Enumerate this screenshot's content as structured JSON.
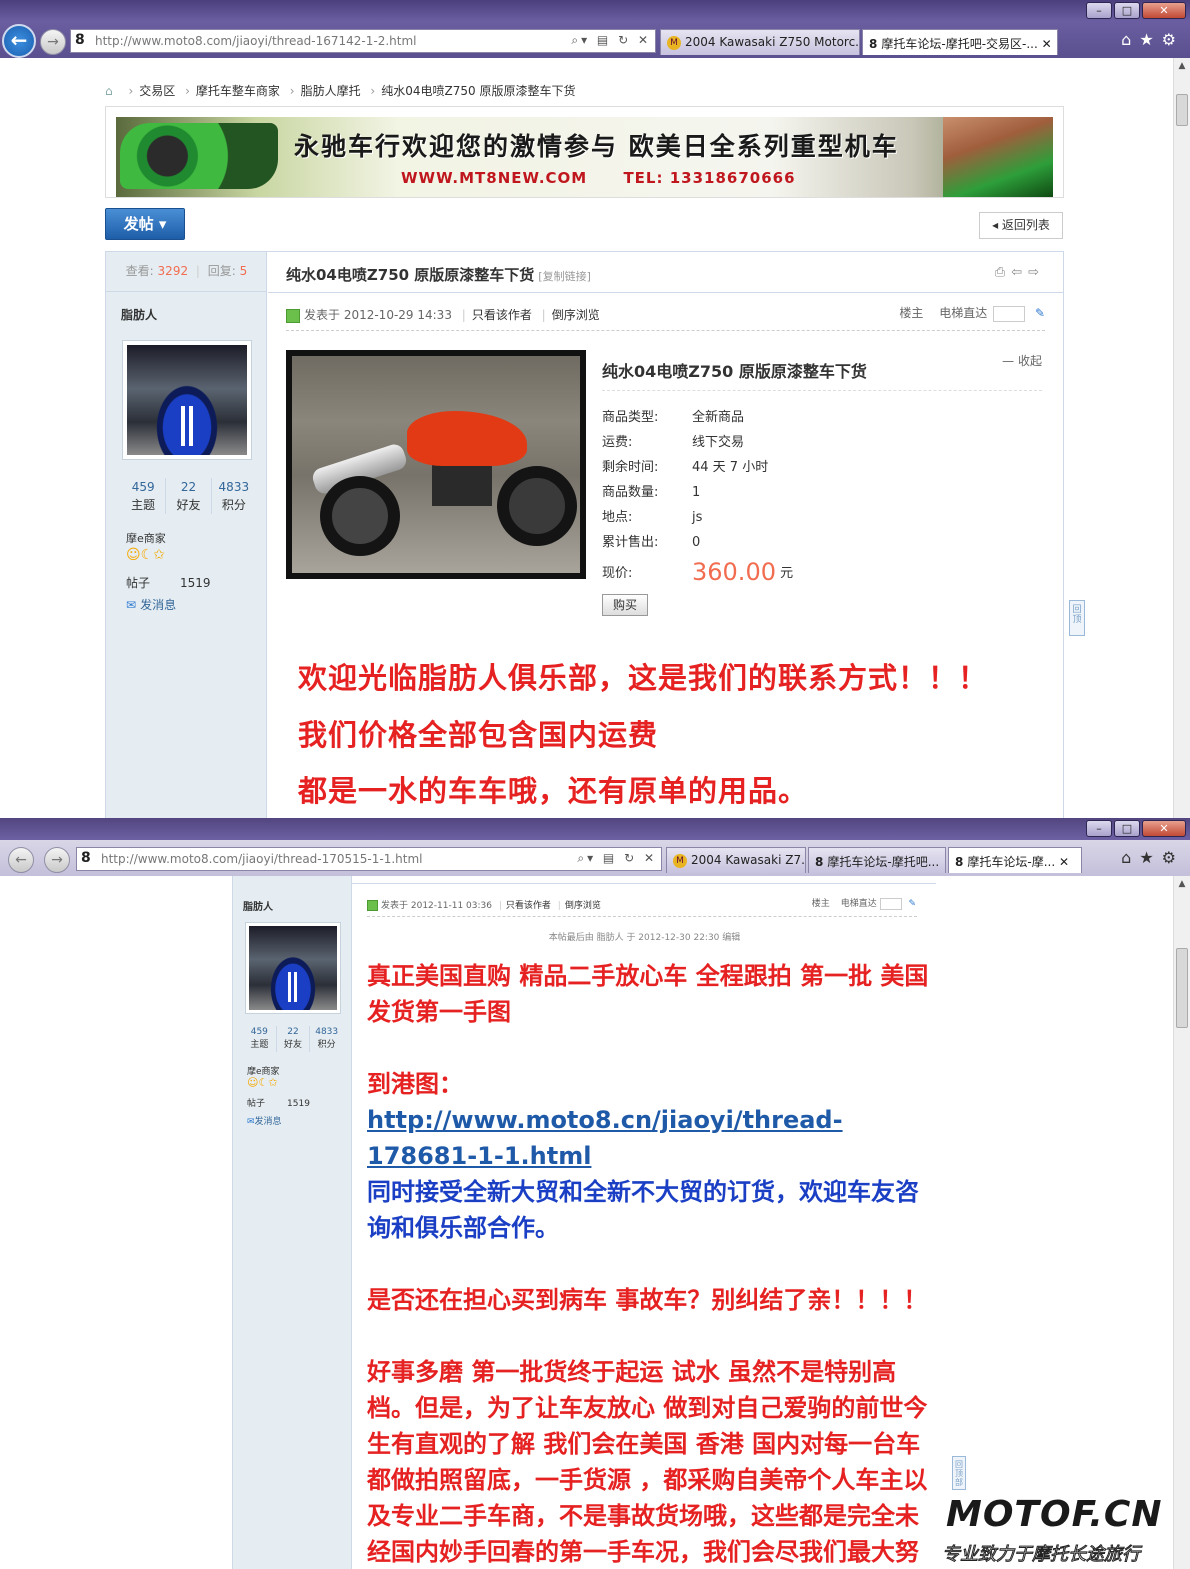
{
  "window1": {
    "url": "http://www.moto8.com/jiaoyi/thread-167142-1-2.html",
    "tabs": [
      {
        "label": "2004 Kawasaki Z750 Motorc..."
      },
      {
        "label": "摩托车论坛-摩托吧-交易区-..."
      }
    ],
    "breadcrumb": [
      "交易区",
      "摩托车整车商家",
      "脂肪人摩托",
      "纯水04电喷Z750 原版原漆整车下货"
    ],
    "banner": {
      "line1": "永驰车行欢迎您的激情参与 欧美日全系列重型机车",
      "site": "WWW.MT8NEW.COM",
      "tel": "TEL: 13318670666"
    },
    "post_button": "发帖",
    "back_to_list": "返回列表",
    "stats": {
      "views_label": "查看:",
      "views": "3292",
      "replies_label": "回复:",
      "replies": "5"
    },
    "thread_title": "纯水04电喷Z750 原版原漆整车下货",
    "copy_link": "[复制链接]",
    "user": {
      "name": "脂肪人",
      "topics": "459",
      "topics_label": "主题",
      "friends": "22",
      "friends_label": "好友",
      "points": "4833",
      "points_label": "积分",
      "group": "摩e商家",
      "posts_label": "帖子",
      "posts": "1519",
      "message": "发消息"
    },
    "post_meta": {
      "posted": "发表于 2012-10-29 14:33",
      "only_author": "只看该作者",
      "reverse": "倒序浏览",
      "floor": "楼主",
      "elevator": "电梯直达"
    },
    "product": {
      "title": "纯水04电喷Z750 原版原漆整车下货",
      "collapse": "收起",
      "rows": [
        {
          "k": "商品类型:",
          "v": "全新商品"
        },
        {
          "k": "运费:",
          "v": "线下交易"
        },
        {
          "k": "剩余时间:",
          "v": "44 天 7 小时"
        },
        {
          "k": "商品数量:",
          "v": "1"
        },
        {
          "k": "地点:",
          "v": "js"
        },
        {
          "k": "累计售出:",
          "v": "0"
        }
      ],
      "price_label": "现价:",
      "price": "360.00",
      "currency": "元",
      "buy": "购买"
    },
    "body_lines": [
      "欢迎光临脂肪人俱乐部，这是我们的联系方式！！！",
      "我们价格全部包含国内运费",
      "都是一水的车车哦，还有原单的用品。"
    ],
    "side_tool": "回顶"
  },
  "window2": {
    "url": "http://www.moto8.com/jiaoyi/thread-170515-1-1.html",
    "tabs": [
      {
        "label": "2004 Kawasaki Z7..."
      },
      {
        "label": "摩托车论坛-摩托吧..."
      },
      {
        "label": "摩托车论坛-摩..."
      }
    ],
    "user": {
      "name": "脂肪人",
      "topics": "459",
      "topics_label": "主题",
      "friends": "22",
      "friends_label": "好友",
      "points": "4833",
      "points_label": "积分",
      "group": "摩e商家",
      "posts_label": "帖子",
      "posts": "1519",
      "message": "发消息"
    },
    "post_meta": {
      "posted": "发表于 2012-11-11 03:36",
      "only_author": "只看该作者",
      "reverse": "倒序浏览",
      "floor": "楼主",
      "elevator": "电梯直达"
    },
    "edited": "本帖最后由 脂肪人 于 2012-12-30 22:30 编辑",
    "para1": "真正美国直购 精品二手放心车 全程跟拍 第一批 美国发货第一手图",
    "para2_label": "到港图：",
    "para2_link": "http://www.moto8.cn/jiaoyi/thread-178681-1-1.html",
    "para3": "同时接受全新大贸和全新不大贸的订货，欢迎车友咨询和俱乐部合作。",
    "para4": "是否还在担心买到病车 事故车？别纠结了亲！！！！",
    "para5": "好事多磨 第一批货终于起运 试水 虽然不是特别高档。但是，为了让车友放心 做到对自己爱驹的前世今生有直观的了解 我们会在美国 香港 国内对每一台车都做拍照留底，一手货源 ，都采购自美帝个人车主以及专业二手车商，不是事故货场哦，这些都是完全未经国内妙手回春的第一手车况，我们会尽我们最大努",
    "side_tool": "回顶部"
  },
  "watermark": {
    "logo": "MOTOF.CN",
    "slogan": "专业致力于摩托长途旅行"
  }
}
